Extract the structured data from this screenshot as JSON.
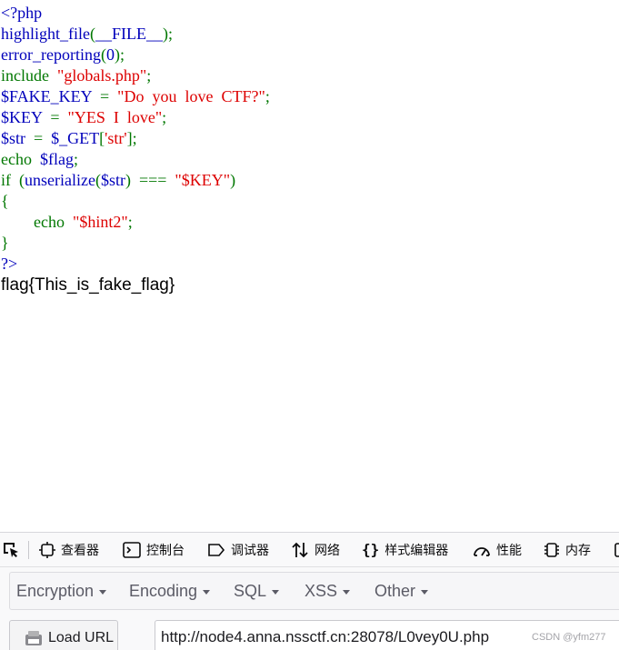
{
  "source_code": {
    "lines": [
      [
        {
          "t": "<?php",
          "c": "default"
        }
      ],
      [
        {
          "t": "highlight_file",
          "c": "default"
        },
        {
          "t": "(",
          "c": "keyword"
        },
        {
          "t": "__FILE__",
          "c": "default"
        },
        {
          "t": ");",
          "c": "keyword"
        }
      ],
      [
        {
          "t": "error_reporting",
          "c": "default"
        },
        {
          "t": "(",
          "c": "keyword"
        },
        {
          "t": "0",
          "c": "default"
        },
        {
          "t": ");",
          "c": "keyword"
        }
      ],
      [
        {
          "t": "include  ",
          "c": "keyword"
        },
        {
          "t": "\"globals.php\"",
          "c": "string"
        },
        {
          "t": ";",
          "c": "keyword"
        }
      ],
      [
        {
          "t": "$FAKE_KEY  ",
          "c": "default"
        },
        {
          "t": "=  ",
          "c": "keyword"
        },
        {
          "t": "\"Do  you  love  CTF?\"",
          "c": "string"
        },
        {
          "t": ";",
          "c": "keyword"
        }
      ],
      [
        {
          "t": "$KEY  ",
          "c": "default"
        },
        {
          "t": "=  ",
          "c": "keyword"
        },
        {
          "t": "\"YES  I  love\"",
          "c": "string"
        },
        {
          "t": ";",
          "c": "keyword"
        }
      ],
      [
        {
          "t": "$str  ",
          "c": "default"
        },
        {
          "t": "=  ",
          "c": "keyword"
        },
        {
          "t": "$_GET",
          "c": "default"
        },
        {
          "t": "[",
          "c": "keyword"
        },
        {
          "t": "'str'",
          "c": "string"
        },
        {
          "t": "];",
          "c": "keyword"
        }
      ],
      [
        {
          "t": "echo  ",
          "c": "keyword"
        },
        {
          "t": "$flag",
          "c": "default"
        },
        {
          "t": ";",
          "c": "keyword"
        }
      ],
      [
        {
          "t": "if  (",
          "c": "keyword"
        },
        {
          "t": "unserialize",
          "c": "default"
        },
        {
          "t": "(",
          "c": "keyword"
        },
        {
          "t": "$str",
          "c": "default"
        },
        {
          "t": ")  ===  ",
          "c": "keyword"
        },
        {
          "t": "\"$KEY\"",
          "c": "string"
        },
        {
          "t": ")",
          "c": "keyword"
        }
      ],
      [
        {
          "t": "{",
          "c": "keyword"
        }
      ],
      [
        {
          "t": "        echo  ",
          "c": "keyword"
        },
        {
          "t": "\"$hint2\"",
          "c": "string"
        },
        {
          "t": ";",
          "c": "keyword"
        }
      ],
      [
        {
          "t": "}",
          "c": "keyword"
        }
      ],
      [
        {
          "t": "?>",
          "c": "default"
        }
      ]
    ]
  },
  "output_text": "flag{This_is_fake_flag}",
  "devtools": {
    "tools": [
      {
        "label": "查看器",
        "icon": "inspector-icon"
      },
      {
        "label": "控制台",
        "icon": "console-icon"
      },
      {
        "label": "调试器",
        "icon": "debugger-icon"
      },
      {
        "label": "网络",
        "icon": "network-icon"
      },
      {
        "label": "样式编辑器",
        "icon": "style-editor-icon"
      },
      {
        "label": "性能",
        "icon": "performance-icon"
      },
      {
        "label": "内存",
        "icon": "memory-icon"
      }
    ]
  },
  "hackbar": {
    "menu": [
      {
        "label": "Encryption"
      },
      {
        "label": "Encoding"
      },
      {
        "label": "SQL"
      },
      {
        "label": "XSS"
      },
      {
        "label": "Other"
      }
    ],
    "load_url_label": "Load URL",
    "url_value": "http://node4.anna.nssctf.cn:28078/L0vey0U.php"
  },
  "watermark": "CSDN @yfm277",
  "colors": {
    "php_default": "#0000bb",
    "php_keyword": "#007700",
    "php_string": "#dd0000"
  }
}
